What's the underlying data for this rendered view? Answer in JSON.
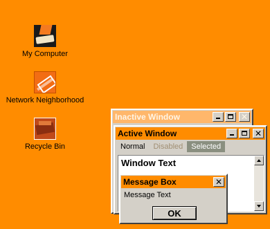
{
  "desktop": {
    "background": "#ff8c00",
    "icons": [
      {
        "label": "My Computer",
        "icon": "my-computer-icon"
      },
      {
        "label": "Network Neighborhood",
        "icon": "network-neighborhood-icon"
      },
      {
        "label": "Recycle Bin",
        "icon": "recycle-bin-icon"
      }
    ]
  },
  "inactive_window": {
    "title": "Inactive Window",
    "title_color": "#ffb76b"
  },
  "active_window": {
    "title": "Active Window",
    "title_color": "#ff8c00",
    "menu": {
      "normal": "Normal",
      "disabled": "Disabled",
      "selected": "Selected"
    },
    "text": "Window Text"
  },
  "message_box": {
    "title": "Message Box",
    "text": "Message Text",
    "ok_label": "OK"
  }
}
